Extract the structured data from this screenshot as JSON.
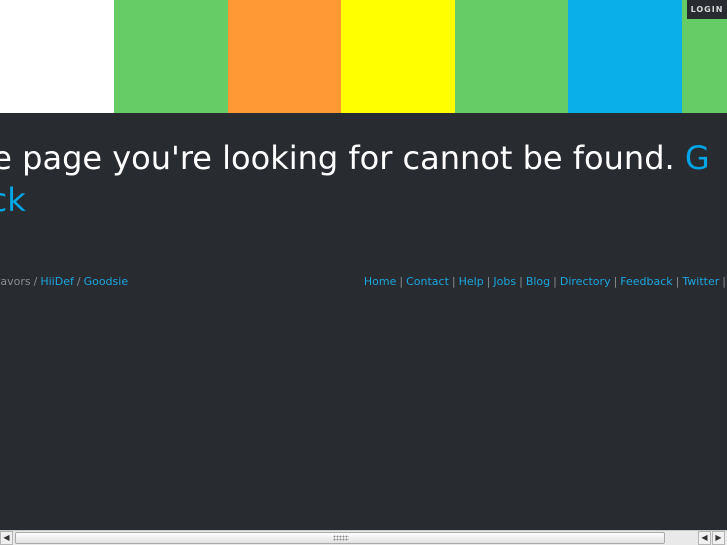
{
  "stripes": [
    {
      "color": "#ffffff"
    },
    {
      "color": "#66cc66"
    },
    {
      "color": "#ff9933"
    },
    {
      "color": "#ffff00"
    },
    {
      "color": "#66cc66"
    },
    {
      "color": "#0aaee8"
    },
    {
      "color": "#66cc66"
    }
  ],
  "header": {
    "login_label": "LOGIN"
  },
  "error": {
    "message": "he page you're looking for cannot be found. ",
    "back_link_start": "G",
    "back_link_end": "ack"
  },
  "footer": {
    "left_prefix": ", Flavors",
    "left_links": [
      "HiiDef",
      "Goodsie"
    ],
    "right_links": [
      "Home",
      "Contact",
      "Help",
      "Jobs",
      "Blog",
      "Directory",
      "Feedback",
      "Twitter"
    ],
    "separator": "|",
    "left_separator": "/"
  },
  "scrollbar": {
    "left_arrow": "◀",
    "right_arrow": "▶"
  },
  "colors": {
    "background": "#282b30",
    "link": "#00a6e6",
    "text": "#ffffff",
    "muted": "#8a8d91"
  }
}
